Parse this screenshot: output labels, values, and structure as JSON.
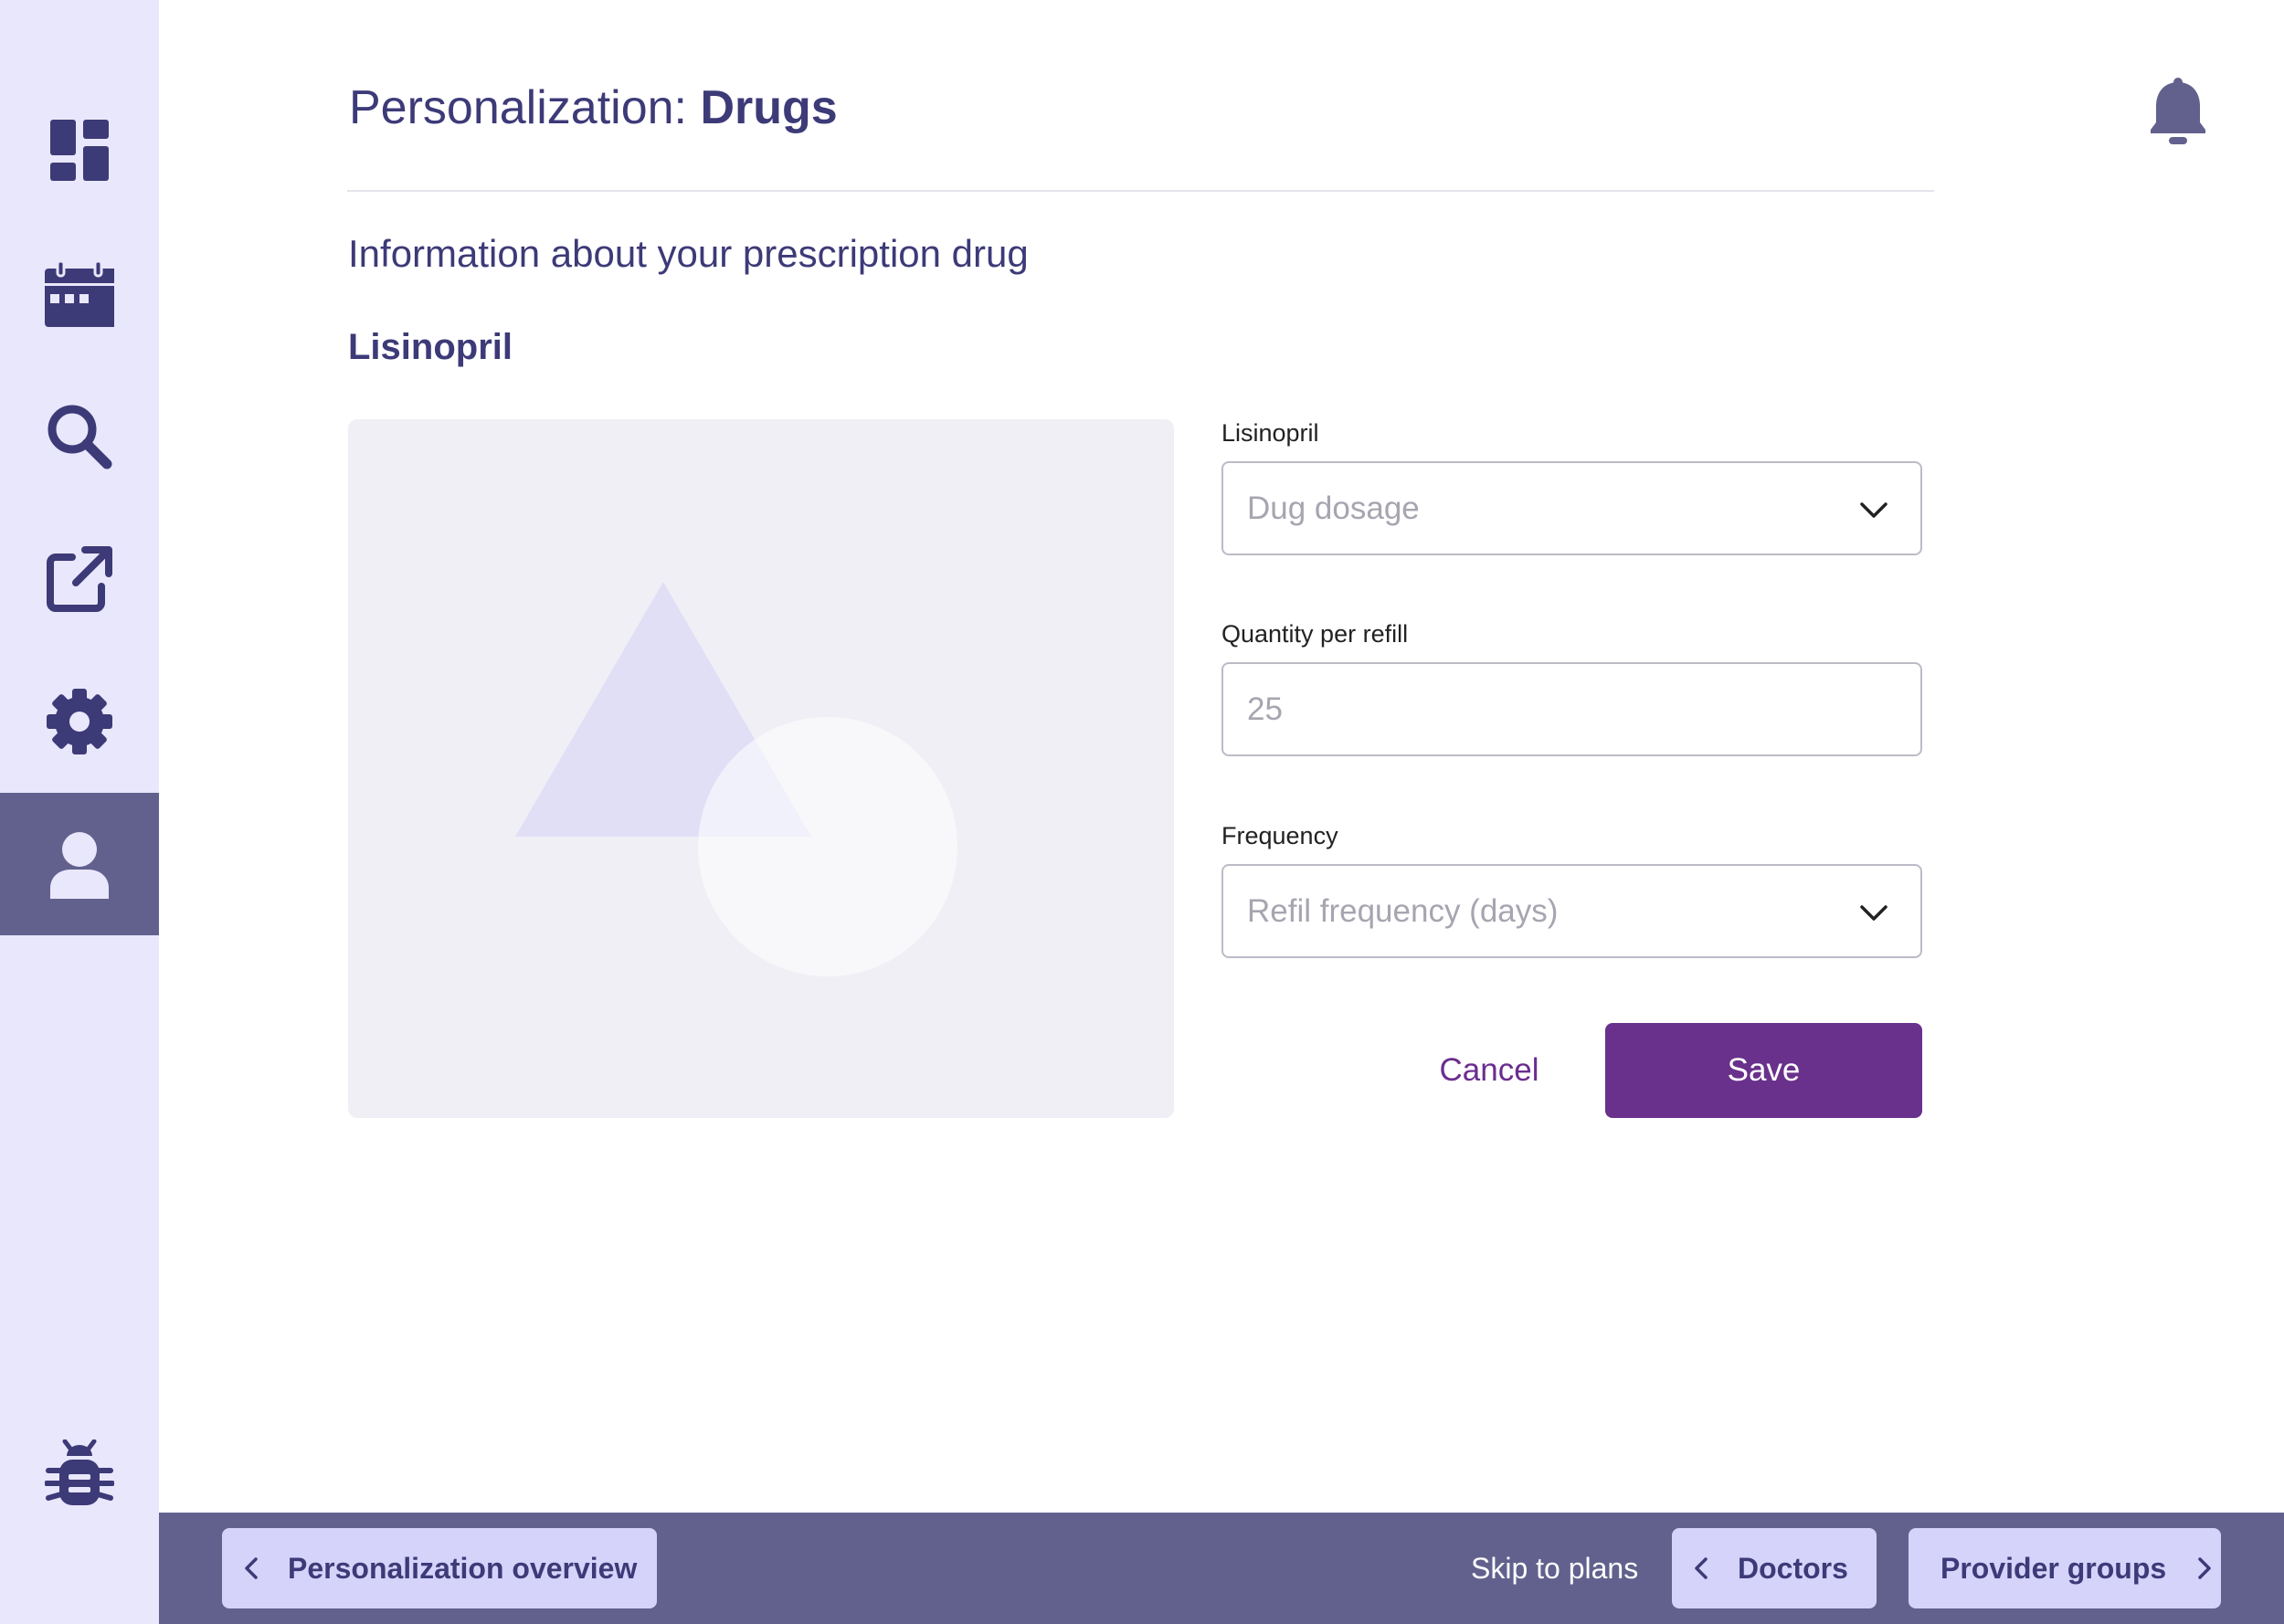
{
  "sidebar": {
    "items": [
      {
        "icon": "dashboard-icon",
        "active": false
      },
      {
        "icon": "calendar-icon",
        "active": false
      },
      {
        "icon": "search-icon",
        "active": false
      },
      {
        "icon": "external-link-icon",
        "active": false
      },
      {
        "icon": "gear-icon",
        "active": false
      },
      {
        "icon": "user-icon",
        "active": true
      }
    ],
    "bottom_icon": "bug-icon"
  },
  "header": {
    "title_prefix": "Personalization: ",
    "title_bold": "Drugs",
    "notification_icon": "bell-icon"
  },
  "main": {
    "section_title": "Information about your prescription drug",
    "drug_name": "Lisinopril",
    "image_placeholder_icon": "image-placeholder-icon",
    "form": {
      "dosage": {
        "label": "Lisinopril",
        "placeholder": "Dug dosage"
      },
      "quantity": {
        "label": "Quantity per refill",
        "placeholder": "25"
      },
      "frequency": {
        "label": "Frequency",
        "placeholder": "Refil frequency (days)"
      },
      "cancel_label": "Cancel",
      "save_label": "Save"
    }
  },
  "footer": {
    "back_label": "Personalization overview",
    "skip_label": "Skip to plans",
    "prev_label": "Doctors",
    "next_label": "Provider groups"
  },
  "colors": {
    "sidebar_bg": "#e9e7fb",
    "sidebar_active": "#62618e",
    "primary_text": "#3d3a78",
    "save_button": "#69308c",
    "footer_bg": "#62618e",
    "footer_button": "#d5d3fa"
  }
}
